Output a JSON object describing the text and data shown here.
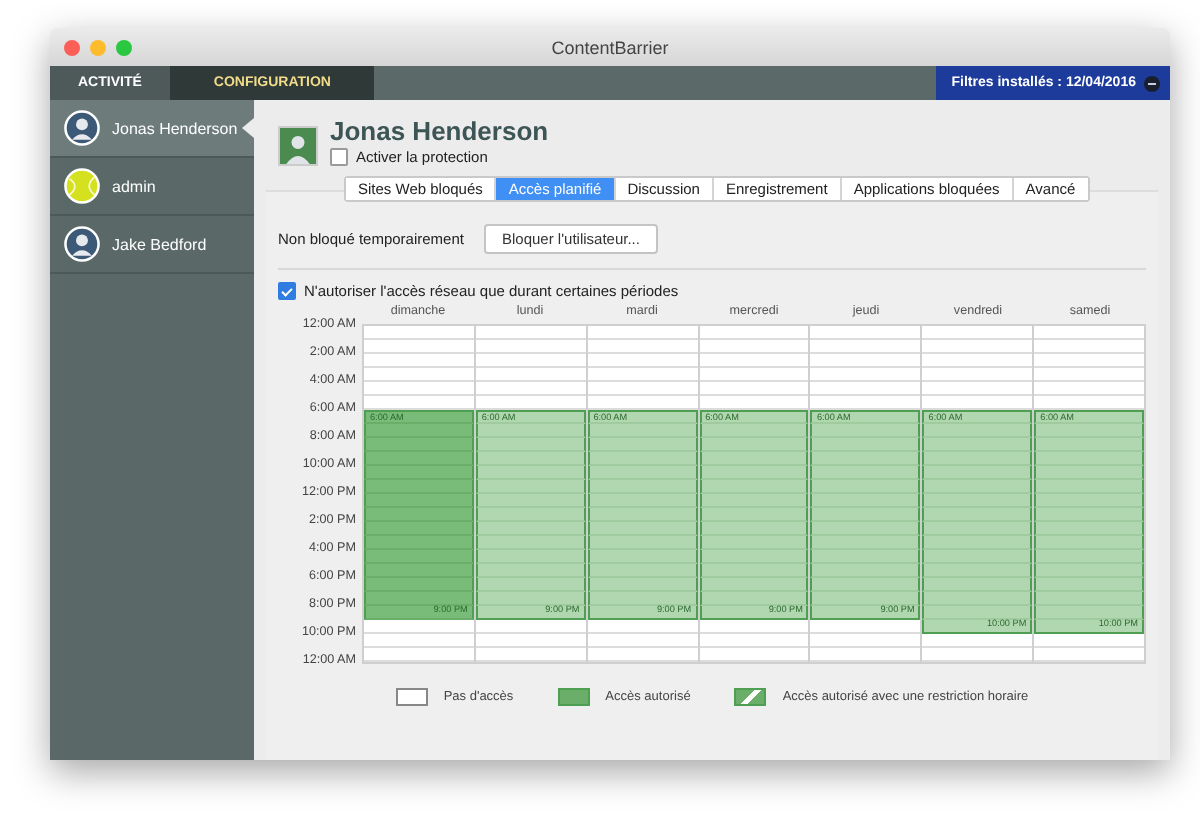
{
  "window": {
    "title": "ContentBarrier"
  },
  "top_tabs": [
    {
      "label": "ACTIVITÉ",
      "selected": false
    },
    {
      "label": "CONFIGURATION",
      "selected": true
    }
  ],
  "filters_badge": "Filtres installés : 12/04/2016",
  "sidebar": {
    "items": [
      {
        "name": "Jonas Henderson",
        "kind": "person",
        "selected": true
      },
      {
        "name": "admin",
        "kind": "ball",
        "selected": false
      },
      {
        "name": "Jake Bedford",
        "kind": "person",
        "selected": false
      }
    ]
  },
  "user": {
    "name": "Jonas Henderson",
    "protection_label": "Activer la protection",
    "protection_checked": false
  },
  "tabs": [
    {
      "label": "Sites Web bloqués",
      "selected": false
    },
    {
      "label": "Accès planifié",
      "selected": true
    },
    {
      "label": "Discussion",
      "selected": false
    },
    {
      "label": "Enregistrement",
      "selected": false
    },
    {
      "label": "Applications bloquées",
      "selected": false
    },
    {
      "label": "Avancé",
      "selected": false
    }
  ],
  "temp_label": "Non bloqué temporairement",
  "block_button": "Bloquer l'utilisateur...",
  "restrict": {
    "label": "N'autoriser l'accès réseau que durant certaines périodes",
    "checked": true
  },
  "time_labels": [
    "12:00 AM",
    "2:00 AM",
    "4:00 AM",
    "6:00 AM",
    "8:00 AM",
    "10:00 AM",
    "12:00 PM",
    "2:00 PM",
    "4:00 PM",
    "6:00 PM",
    "8:00 PM",
    "10:00 PM",
    "12:00 AM"
  ],
  "days": [
    {
      "name": "dimanche",
      "selected": true,
      "start_label": "6:00 AM",
      "end_label": "9:00 PM",
      "hours": [
        false,
        false,
        false,
        false,
        false,
        false,
        true,
        true,
        true,
        true,
        true,
        true,
        true,
        true,
        true,
        true,
        true,
        true,
        true,
        true,
        true,
        false,
        false,
        false
      ]
    },
    {
      "name": "lundi",
      "selected": false,
      "start_label": "6:00 AM",
      "end_label": "9:00 PM",
      "hours": [
        false,
        false,
        false,
        false,
        false,
        false,
        true,
        true,
        true,
        true,
        true,
        true,
        true,
        true,
        true,
        true,
        true,
        true,
        true,
        true,
        true,
        false,
        false,
        false
      ]
    },
    {
      "name": "mardi",
      "selected": false,
      "start_label": "6:00 AM",
      "end_label": "9:00 PM",
      "hours": [
        false,
        false,
        false,
        false,
        false,
        false,
        true,
        true,
        true,
        true,
        true,
        true,
        true,
        true,
        true,
        true,
        true,
        true,
        true,
        true,
        true,
        false,
        false,
        false
      ]
    },
    {
      "name": "mercredi",
      "selected": false,
      "start_label": "6:00 AM",
      "end_label": "9:00 PM",
      "hours": [
        false,
        false,
        false,
        false,
        false,
        false,
        true,
        true,
        true,
        true,
        true,
        true,
        true,
        true,
        true,
        true,
        true,
        true,
        true,
        true,
        true,
        false,
        false,
        false
      ]
    },
    {
      "name": "jeudi",
      "selected": false,
      "start_label": "6:00 AM",
      "end_label": "9:00 PM",
      "hours": [
        false,
        false,
        false,
        false,
        false,
        false,
        true,
        true,
        true,
        true,
        true,
        true,
        true,
        true,
        true,
        true,
        true,
        true,
        true,
        true,
        true,
        false,
        false,
        false
      ]
    },
    {
      "name": "vendredi",
      "selected": false,
      "start_label": "6:00 AM",
      "end_label": "10:00 PM",
      "hours": [
        false,
        false,
        false,
        false,
        false,
        false,
        true,
        true,
        true,
        true,
        true,
        true,
        true,
        true,
        true,
        true,
        true,
        true,
        true,
        true,
        true,
        true,
        false,
        false
      ]
    },
    {
      "name": "samedi",
      "selected": false,
      "start_label": "6:00 AM",
      "end_label": "10:00 PM",
      "hours": [
        false,
        false,
        false,
        false,
        false,
        false,
        true,
        true,
        true,
        true,
        true,
        true,
        true,
        true,
        true,
        true,
        true,
        true,
        true,
        true,
        true,
        true,
        false,
        false
      ]
    }
  ],
  "legend": [
    {
      "kind": "none",
      "label": "Pas d'accès"
    },
    {
      "kind": "allowed",
      "label": "Accès autorisé"
    },
    {
      "kind": "restricted",
      "label": "Accès autorisé avec une restriction horaire"
    }
  ]
}
